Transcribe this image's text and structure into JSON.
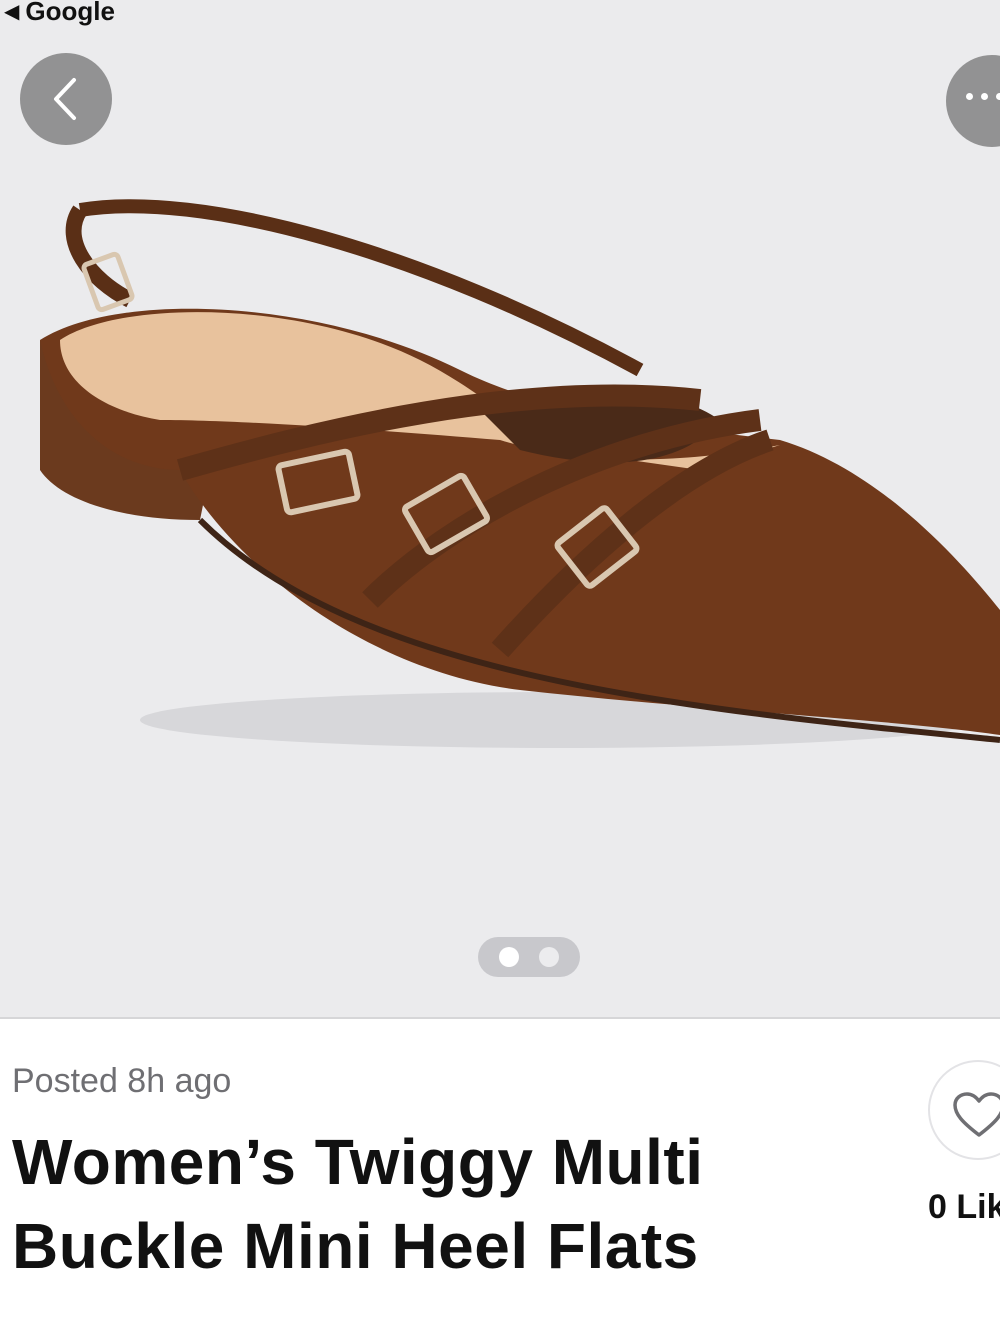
{
  "status_bar": {
    "back_app_label": "Google"
  },
  "photo": {
    "description_icon": "product-photo",
    "pager": {
      "total": 2,
      "active_index": 0
    }
  },
  "listing": {
    "posted": "Posted 8h ago",
    "title": "Women’s Twiggy Multi Buckle Mini Heel Flats",
    "like_count_label": "0 Lik"
  },
  "colors": {
    "photo_bg": "#ebebed",
    "shoe_brown": "#6e3a1c",
    "overlay_button": "#828282"
  }
}
